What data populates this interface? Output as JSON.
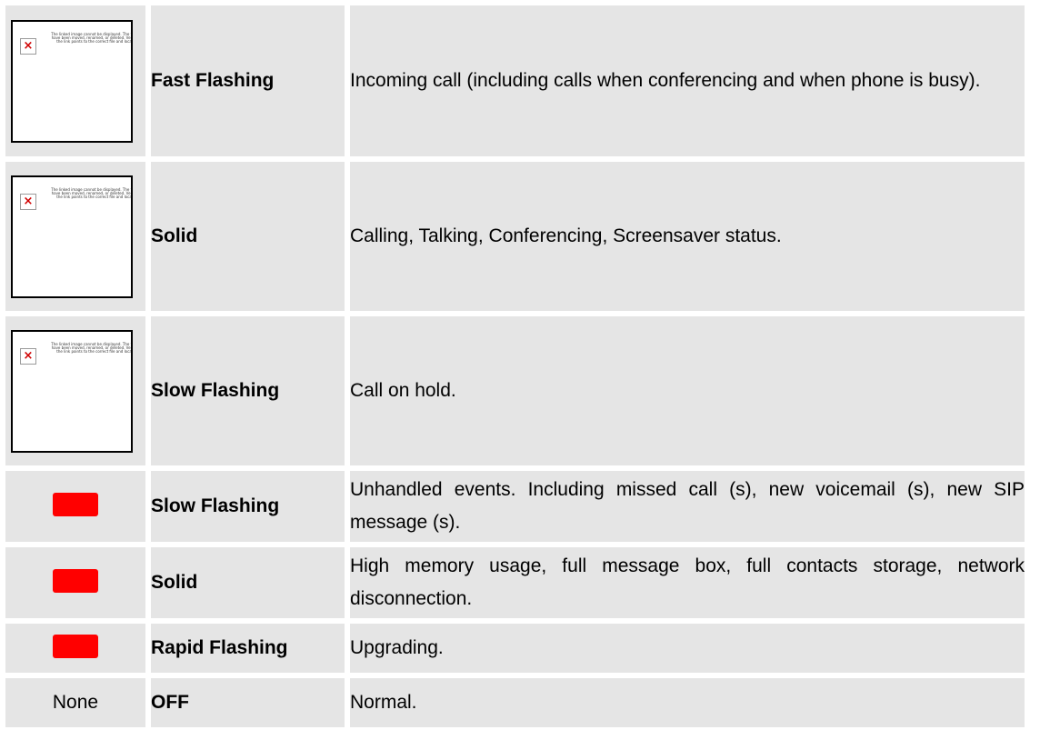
{
  "colors": {
    "led_red": "#ff0000",
    "cell_bg": "#e5e5e5"
  },
  "rows": [
    {
      "icon": "broken-image-icon",
      "placeholder_text": "The linked image cannot be displayed. The file may have been moved, renamed, or deleted. Verify that the link points to the correct file and location.",
      "x_glyph": "×",
      "pattern": "Fast Flashing",
      "description": "Incoming call (including calls when conferencing and when phone is busy)."
    },
    {
      "icon": "broken-image-icon",
      "placeholder_text": "The linked image cannot be displayed. The file may have been moved, renamed, or deleted. Verify that the link points to the correct file and location.",
      "x_glyph": "×",
      "pattern": "Solid",
      "description": "Calling, Talking, Conferencing, Screensaver status."
    },
    {
      "icon": "broken-image-icon",
      "placeholder_text": "The linked image cannot be displayed. The file may have been moved, renamed, or deleted. Verify that the link points to the correct file and location.",
      "x_glyph": "×",
      "pattern": "Slow Flashing",
      "description": "Call on hold."
    },
    {
      "icon": "red-led-icon",
      "pattern": "Slow Flashing",
      "description": "Unhandled events. Including missed call (s), new voicemail (s), new SIP message (s)."
    },
    {
      "icon": "red-led-icon",
      "pattern": "Solid",
      "description": "High memory usage, full message box, full contacts storage, network disconnection."
    },
    {
      "icon": "red-led-icon",
      "pattern": "Rapid Flashing",
      "description": "Upgrading."
    },
    {
      "icon_text": "None",
      "pattern": "OFF",
      "description": "Normal."
    }
  ]
}
